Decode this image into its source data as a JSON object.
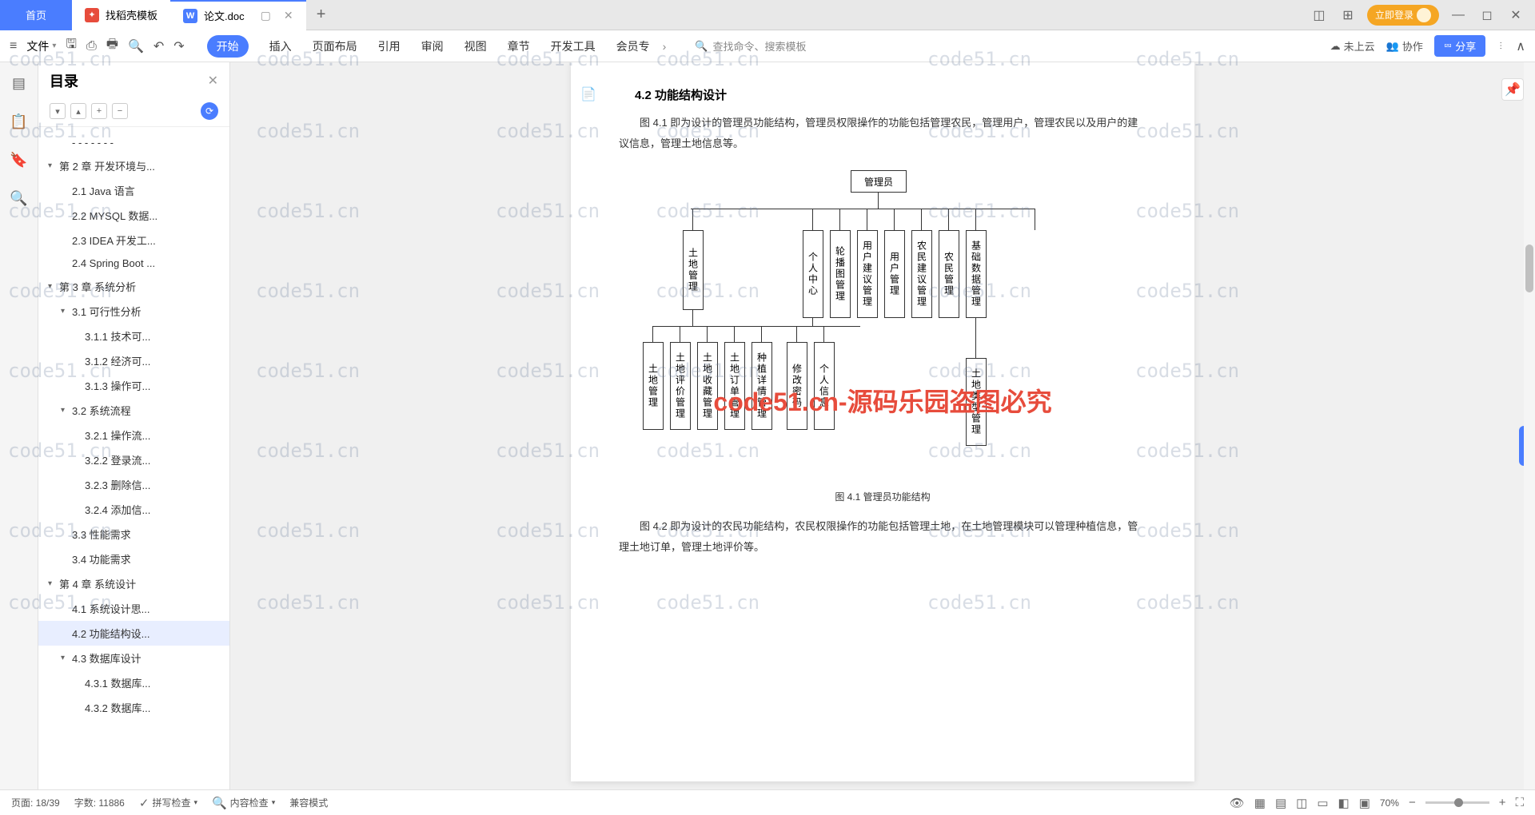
{
  "tabs": {
    "home": "首页",
    "template": "找稻壳模板",
    "active": "论文.doc"
  },
  "login_btn": "立即登录",
  "toolbar": {
    "file": "文件",
    "menu": [
      "开始",
      "插入",
      "页面布局",
      "引用",
      "审阅",
      "视图",
      "章节",
      "开发工具",
      "会员专"
    ],
    "search": "查找命令、搜索模板",
    "cloud": "未上云",
    "collab": "协作",
    "share": "分享"
  },
  "outline": {
    "title": "目录",
    "items": [
      {
        "l": 1,
        "t": "- - - - - - -",
        "c": ""
      },
      {
        "l": 0,
        "t": "第 2 章 开发环境与...",
        "c": "▾"
      },
      {
        "l": 1,
        "t": "2.1 Java 语言",
        "c": ""
      },
      {
        "l": 1,
        "t": "2.2 MYSQL 数据...",
        "c": ""
      },
      {
        "l": 1,
        "t": "2.3 IDEA 开发工...",
        "c": ""
      },
      {
        "l": 1,
        "t": "2.4 Spring Boot ...",
        "c": ""
      },
      {
        "l": 0,
        "t": "第 3 章 系统分析",
        "c": "▾"
      },
      {
        "l": 1,
        "t": "3.1 可行性分析",
        "c": "▾"
      },
      {
        "l": 2,
        "t": "3.1.1 技术可...",
        "c": ""
      },
      {
        "l": 2,
        "t": "3.1.2 经济可...",
        "c": ""
      },
      {
        "l": 2,
        "t": "3.1.3 操作可...",
        "c": ""
      },
      {
        "l": 1,
        "t": "3.2 系统流程",
        "c": "▾"
      },
      {
        "l": 2,
        "t": "3.2.1 操作流...",
        "c": ""
      },
      {
        "l": 2,
        "t": "3.2.2 登录流...",
        "c": ""
      },
      {
        "l": 2,
        "t": "3.2.3 删除信...",
        "c": ""
      },
      {
        "l": 2,
        "t": "3.2.4 添加信...",
        "c": ""
      },
      {
        "l": 1,
        "t": "3.3 性能需求",
        "c": ""
      },
      {
        "l": 1,
        "t": "3.4 功能需求",
        "c": ""
      },
      {
        "l": 0,
        "t": "第 4 章  系统设计",
        "c": "▾"
      },
      {
        "l": 1,
        "t": "4.1 系统设计思...",
        "c": ""
      },
      {
        "l": 1,
        "t": "4.2 功能结构设...",
        "c": "",
        "sel": true
      },
      {
        "l": 1,
        "t": "4.3 数据库设计",
        "c": "▾"
      },
      {
        "l": 2,
        "t": "4.3.1 数据库...",
        "c": ""
      },
      {
        "l": 2,
        "t": "4.3.2 数据库...",
        "c": ""
      }
    ]
  },
  "doc": {
    "section_title": "4.2  功能结构设计",
    "p1": "图 4.1 即为设计的管理员功能结构，管理员权限操作的功能包括管理农民，管理用户，管理农民以及用户的建议信息，管理土地信息等。",
    "caption1": "图 4.1 管理员功能结构",
    "p2": "图 4.2 即为设计的农民功能结构，农民权限操作的功能包括管理土地，在土地管理模块可以管理种植信息，管理土地订单，管理土地评价等。",
    "diagram": {
      "root": "管理员",
      "level1": [
        "土地管理",
        "个人中心",
        "轮播图管理",
        "用户建议管理",
        "用户管理",
        "农民建议管理",
        "农民管理",
        "基础数据管理"
      ],
      "sub_tudi": [
        "土地管理",
        "土地评价管理",
        "土地收藏管理",
        "土地订单管理",
        "种植详情管理",
        "修改密码",
        "个人信息"
      ],
      "sub_jichu": "土地类型管理"
    }
  },
  "status": {
    "page": "页面: 18/39",
    "words": "字数: 11886",
    "spell": "拼写检查",
    "content": "内容检查",
    "compat": "兼容模式",
    "zoom": "70%"
  },
  "watermark": "code51.cn",
  "watermark_red": "code51.cn-源码乐园盗图必究"
}
